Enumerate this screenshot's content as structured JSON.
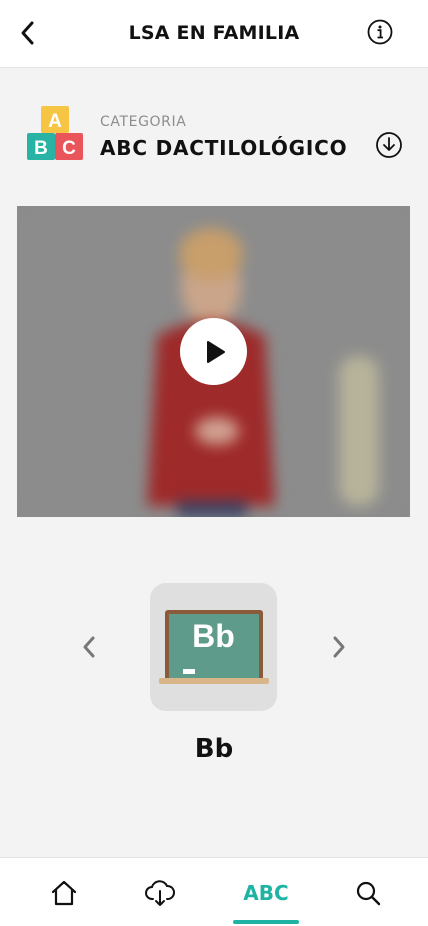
{
  "header": {
    "title": "LSA EN FAMILIA",
    "back_icon": "chevron-left-icon",
    "info_icon": "info-icon"
  },
  "category": {
    "label": "CATEGORIA",
    "name": "ABC DACTILOLÓGICO",
    "icon": "abc-blocks-icon",
    "icon_letters": [
      "A",
      "B",
      "C"
    ],
    "download_icon": "download-circle-icon"
  },
  "video": {
    "play_icon": "play-icon"
  },
  "letter_card": {
    "board_text": "Bb",
    "label": "Bb",
    "prev_icon": "chevron-left-icon",
    "next_icon": "chevron-right-icon"
  },
  "bottom_nav": {
    "items": [
      {
        "icon": "home-icon"
      },
      {
        "icon": "cloud-download-icon"
      },
      {
        "label": "ABC",
        "active": true
      },
      {
        "icon": "search-icon"
      }
    ],
    "accent_color": "#1fb3a3"
  }
}
